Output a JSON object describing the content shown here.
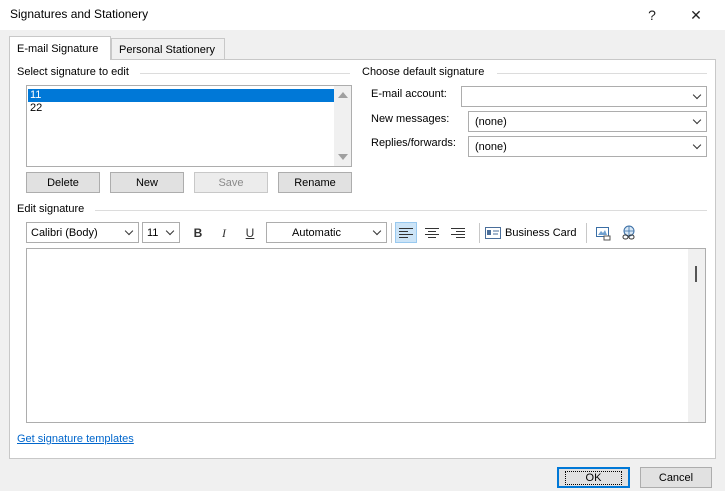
{
  "window": {
    "title": "Signatures and Stationery",
    "help_glyph": "?",
    "close_glyph": "✕"
  },
  "tabs": [
    {
      "label": "E-mail Signature",
      "active": true
    },
    {
      "label": "Personal Stationery",
      "active": false
    }
  ],
  "select_signature": {
    "label": "Select signature to edit",
    "items": [
      {
        "label": "11",
        "selected": true
      },
      {
        "label": "22",
        "selected": false
      }
    ],
    "buttons": {
      "delete": "Delete",
      "new": "New",
      "save": "Save",
      "rename": "Rename"
    }
  },
  "default_signature": {
    "label": "Choose default signature",
    "email_account_label": "E-mail account:",
    "email_account_value": "",
    "new_messages_label": "New messages:",
    "new_messages_value": "(none)",
    "replies_label": "Replies/forwards:",
    "replies_value": "(none)"
  },
  "edit_signature": {
    "label": "Edit signature",
    "font": "Calibri (Body)",
    "size": "11",
    "bold": "B",
    "italic": "I",
    "underline": "U",
    "color": "Automatic",
    "business_card": "Business Card"
  },
  "link_text": "Get signature templates",
  "footer": {
    "ok": "OK",
    "cancel": "Cancel"
  },
  "colors": {
    "accent": "#0078d7",
    "link": "#0066cc",
    "dialog_bg": "#f0f0f0"
  },
  "icons": [
    "help-icon",
    "close-icon",
    "scroll-up-icon",
    "scroll-down-icon",
    "chevron-down-icon",
    "align-left-icon",
    "align-center-icon",
    "align-right-icon",
    "business-card-icon",
    "insert-picture-icon",
    "hyperlink-icon"
  ]
}
